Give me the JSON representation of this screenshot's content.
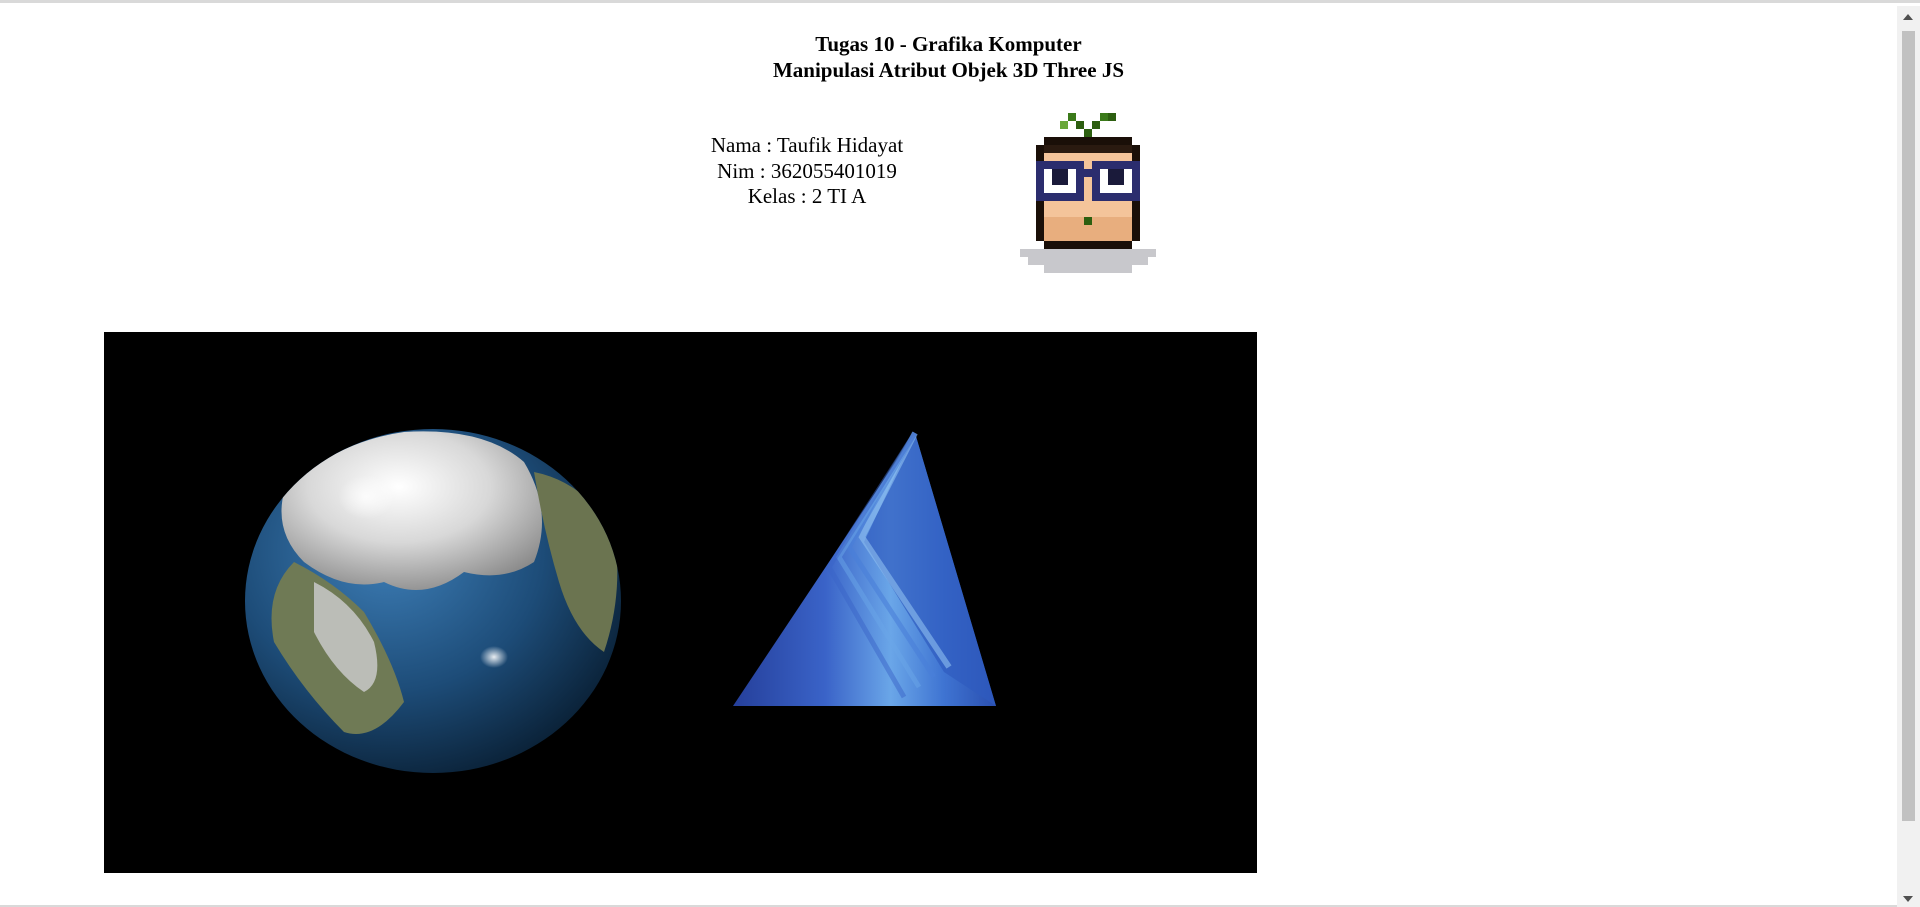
{
  "header": {
    "title_line1": "Tugas 10 - Grafika Komputer",
    "title_line2": "Manipulasi Atribut Objek 3D Three JS"
  },
  "student": {
    "nama": "Nama : Taufik Hidayat",
    "nim": "Nim : 362055401019",
    "kelas": "Kelas : 2 TI A"
  },
  "avatar": {
    "icon": "pixel-nerd-avatar-icon"
  },
  "scene": {
    "background_color": "#000000",
    "objects": [
      "earth-sphere",
      "blue-tetrahedron"
    ]
  },
  "colors": {
    "ocean": "#1f4e7a",
    "land": "#5d7a3a",
    "ice": "#e6e6e6",
    "pyramid": "#3b6fd0"
  }
}
